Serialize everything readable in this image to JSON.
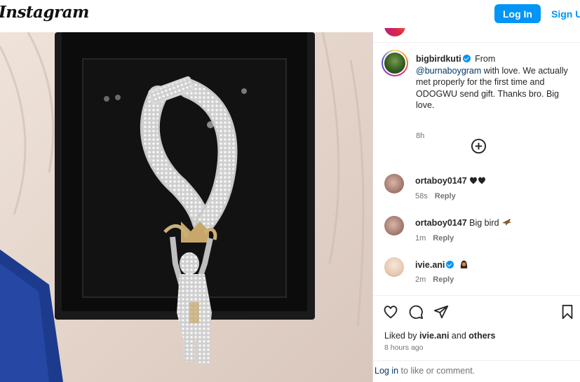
{
  "header": {
    "logo": "Instagram",
    "login_label": "Log In",
    "signup_label": "Sign Up"
  },
  "caption": {
    "username": "bigbirdkuti",
    "text_before": "From",
    "mention": "@burnaboygram",
    "text_after": "with love. We actually met properly for the first time and ODOGWU send gift. Thanks bro. Big love.",
    "time": "8h"
  },
  "comments": [
    {
      "username": "ortaboy0147",
      "text": "",
      "emoji": "black-hearts",
      "time": "58s",
      "reply": "Reply"
    },
    {
      "username": "ortaboy0147",
      "text": "Big bird",
      "emoji": "bird",
      "time": "1m",
      "reply": "Reply"
    },
    {
      "username": "ivie.ani",
      "text": "",
      "emoji": "person",
      "time": "2m",
      "reply": "Reply",
      "verified": true
    }
  ],
  "footer": {
    "liked_by_prefix": "Liked by",
    "liked_by_user": "ivie.ani",
    "liked_by_and": "and",
    "liked_by_others": "others",
    "post_time": "8 hours ago",
    "login_link": "Log in",
    "login_suffix": "to like or comment."
  },
  "colors": {
    "accent": "#0095f6",
    "mention": "#00376b",
    "muted": "#737373"
  }
}
